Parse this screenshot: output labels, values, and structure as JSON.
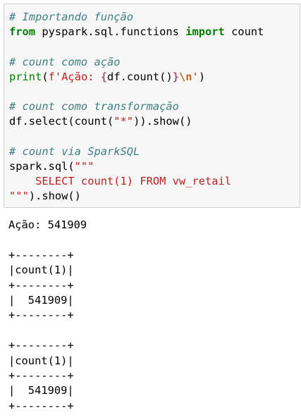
{
  "code_cell": {
    "lines": [
      [
        {
          "t": "# Importando função",
          "c": "cm"
        }
      ],
      [
        {
          "t": "from",
          "c": "kw"
        },
        {
          "t": " pyspark.sql.functions ",
          "c": "pl"
        },
        {
          "t": "import",
          "c": "kw"
        },
        {
          "t": " count",
          "c": "pl"
        }
      ],
      [],
      [
        {
          "t": "# count como ação",
          "c": "cm"
        }
      ],
      [
        {
          "t": "print",
          "c": "bi"
        },
        {
          "t": "(",
          "c": "pl"
        },
        {
          "t": "f'Ação: ",
          "c": "st"
        },
        {
          "t": "{",
          "c": "si"
        },
        {
          "t": "df.count()",
          "c": "pl"
        },
        {
          "t": "}",
          "c": "si"
        },
        {
          "t": "\\n",
          "c": "es"
        },
        {
          "t": "'",
          "c": "st"
        },
        {
          "t": ")",
          "c": "pl"
        }
      ],
      [],
      [
        {
          "t": "# count como transformação",
          "c": "cm"
        }
      ],
      [
        {
          "t": "df.select(count(",
          "c": "pl"
        },
        {
          "t": "\"*\"",
          "c": "st"
        },
        {
          "t": ")).show()",
          "c": "pl"
        }
      ],
      [],
      [
        {
          "t": "# count via SparkSQL",
          "c": "cm"
        }
      ],
      [
        {
          "t": "spark.sql(",
          "c": "pl"
        },
        {
          "t": "\"\"\"",
          "c": "st"
        }
      ],
      [
        {
          "t": "    SELECT count(1) FROM vw_retail",
          "c": "st"
        }
      ],
      [
        {
          "t": "\"\"\"",
          "c": "st"
        },
        {
          "t": ").show()",
          "c": "pl"
        }
      ]
    ]
  },
  "output": {
    "lines": [
      "Ação: 541909",
      "",
      "+--------+",
      "|count(1)|",
      "+--------+",
      "|  541909|",
      "+--------+",
      "",
      "+--------+",
      "|count(1)|",
      "+--------+",
      "|  541909|",
      "+--------+"
    ]
  }
}
